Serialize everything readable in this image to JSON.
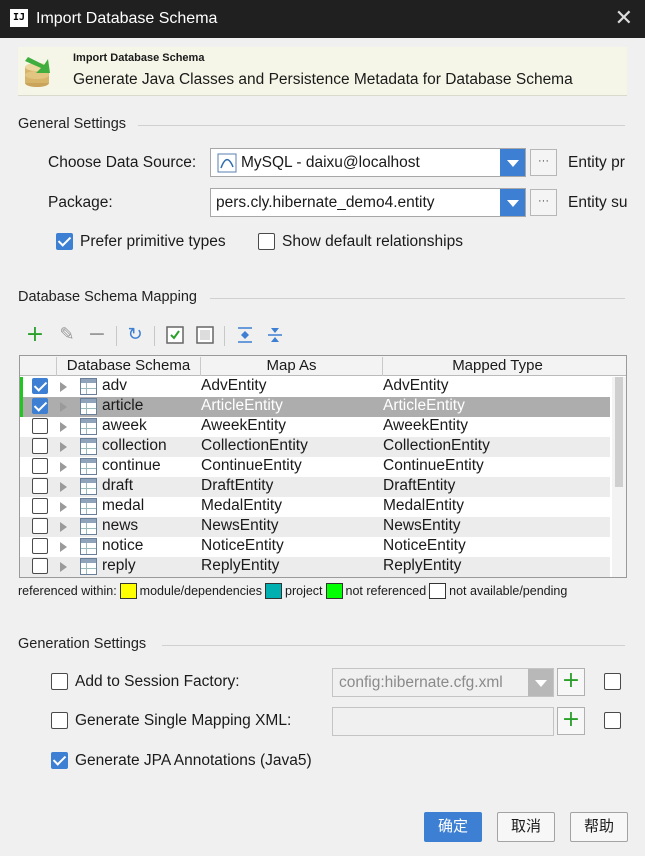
{
  "window": {
    "title": "Import Database Schema",
    "app_icon": "IJ"
  },
  "header": {
    "title": "Import Database Schema",
    "subtitle": "Generate Java Classes and Persistence Metadata for Database Schema"
  },
  "general": {
    "section_title": "General Settings",
    "datasource_label": "Choose Data Source:",
    "datasource_value": "MySQL - daixu@localhost",
    "package_label": "Package:",
    "package_value": "pers.cly.hibernate_demo4.entity",
    "entity_prefix_label": "Entity pr",
    "entity_suffix_label": "Entity su",
    "prefer_primitive_label": "Prefer primitive types",
    "prefer_primitive_checked": true,
    "show_default_label": "Show default relationships",
    "show_default_checked": false
  },
  "mapping": {
    "section_title": "Database Schema Mapping",
    "columns": [
      "Database Schema",
      "Map As",
      "Mapped Type"
    ],
    "rows": [
      {
        "checked": true,
        "name": "adv",
        "map_as": "AdvEntity",
        "type": "AdvEntity"
      },
      {
        "checked": true,
        "name": "article",
        "map_as": "ArticleEntity",
        "type": "ArticleEntity"
      },
      {
        "checked": false,
        "name": "aweek",
        "map_as": "AweekEntity",
        "type": "AweekEntity"
      },
      {
        "checked": false,
        "name": "collection",
        "map_as": "CollectionEntity",
        "type": "CollectionEntity"
      },
      {
        "checked": false,
        "name": "continue",
        "map_as": "ContinueEntity",
        "type": "ContinueEntity"
      },
      {
        "checked": false,
        "name": "draft",
        "map_as": "DraftEntity",
        "type": "DraftEntity"
      },
      {
        "checked": false,
        "name": "medal",
        "map_as": "MedalEntity",
        "type": "MedalEntity"
      },
      {
        "checked": false,
        "name": "news",
        "map_as": "NewsEntity",
        "type": "NewsEntity"
      },
      {
        "checked": false,
        "name": "notice",
        "map_as": "NoticeEntity",
        "type": "NoticeEntity"
      },
      {
        "checked": false,
        "name": "reply",
        "map_as": "ReplyEntity",
        "type": "ReplyEntity"
      }
    ],
    "selected_row": "article",
    "legend": {
      "prefix": "referenced within:",
      "items": [
        {
          "label": "module/dependencies",
          "color": "#ffff00"
        },
        {
          "label": "project",
          "color": "#00b0b0"
        },
        {
          "label": "not referenced",
          "color": "#00ff00"
        },
        {
          "label": "not available/pending",
          "color": "#ffffff"
        }
      ]
    }
  },
  "generation": {
    "section_title": "Generation Settings",
    "session_factory_label": "Add to Session Factory:",
    "session_factory_checked": false,
    "session_factory_value": "config:hibernate.cfg.xml",
    "single_xml_label": "Generate Single Mapping XML:",
    "single_xml_checked": false,
    "jpa_label": "Generate JPA Annotations (Java5)",
    "jpa_checked": true
  },
  "buttons": {
    "ok": "确定",
    "cancel": "取消",
    "help": "帮助"
  },
  "colors": {
    "accent": "#3c7fd3",
    "row_marker": "#22c522"
  }
}
